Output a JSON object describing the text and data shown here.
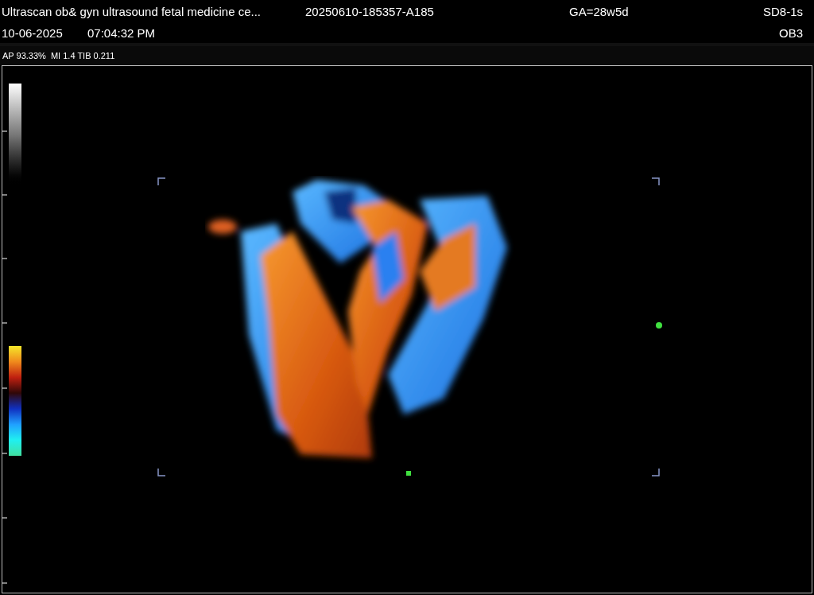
{
  "header": {
    "institution": "Ultrascan ob& gyn ultrasound fetal medicine ce...",
    "study_id": "20250610-185357-A185",
    "gestational_age": "GA=28w5d",
    "probe": "SD8-1s",
    "date": "10-06-2025",
    "time": "07:04:32 PM",
    "preset": "OB3"
  },
  "params": {
    "text": "AP 93.33%  MI 1.4 TIB 0.211"
  }
}
